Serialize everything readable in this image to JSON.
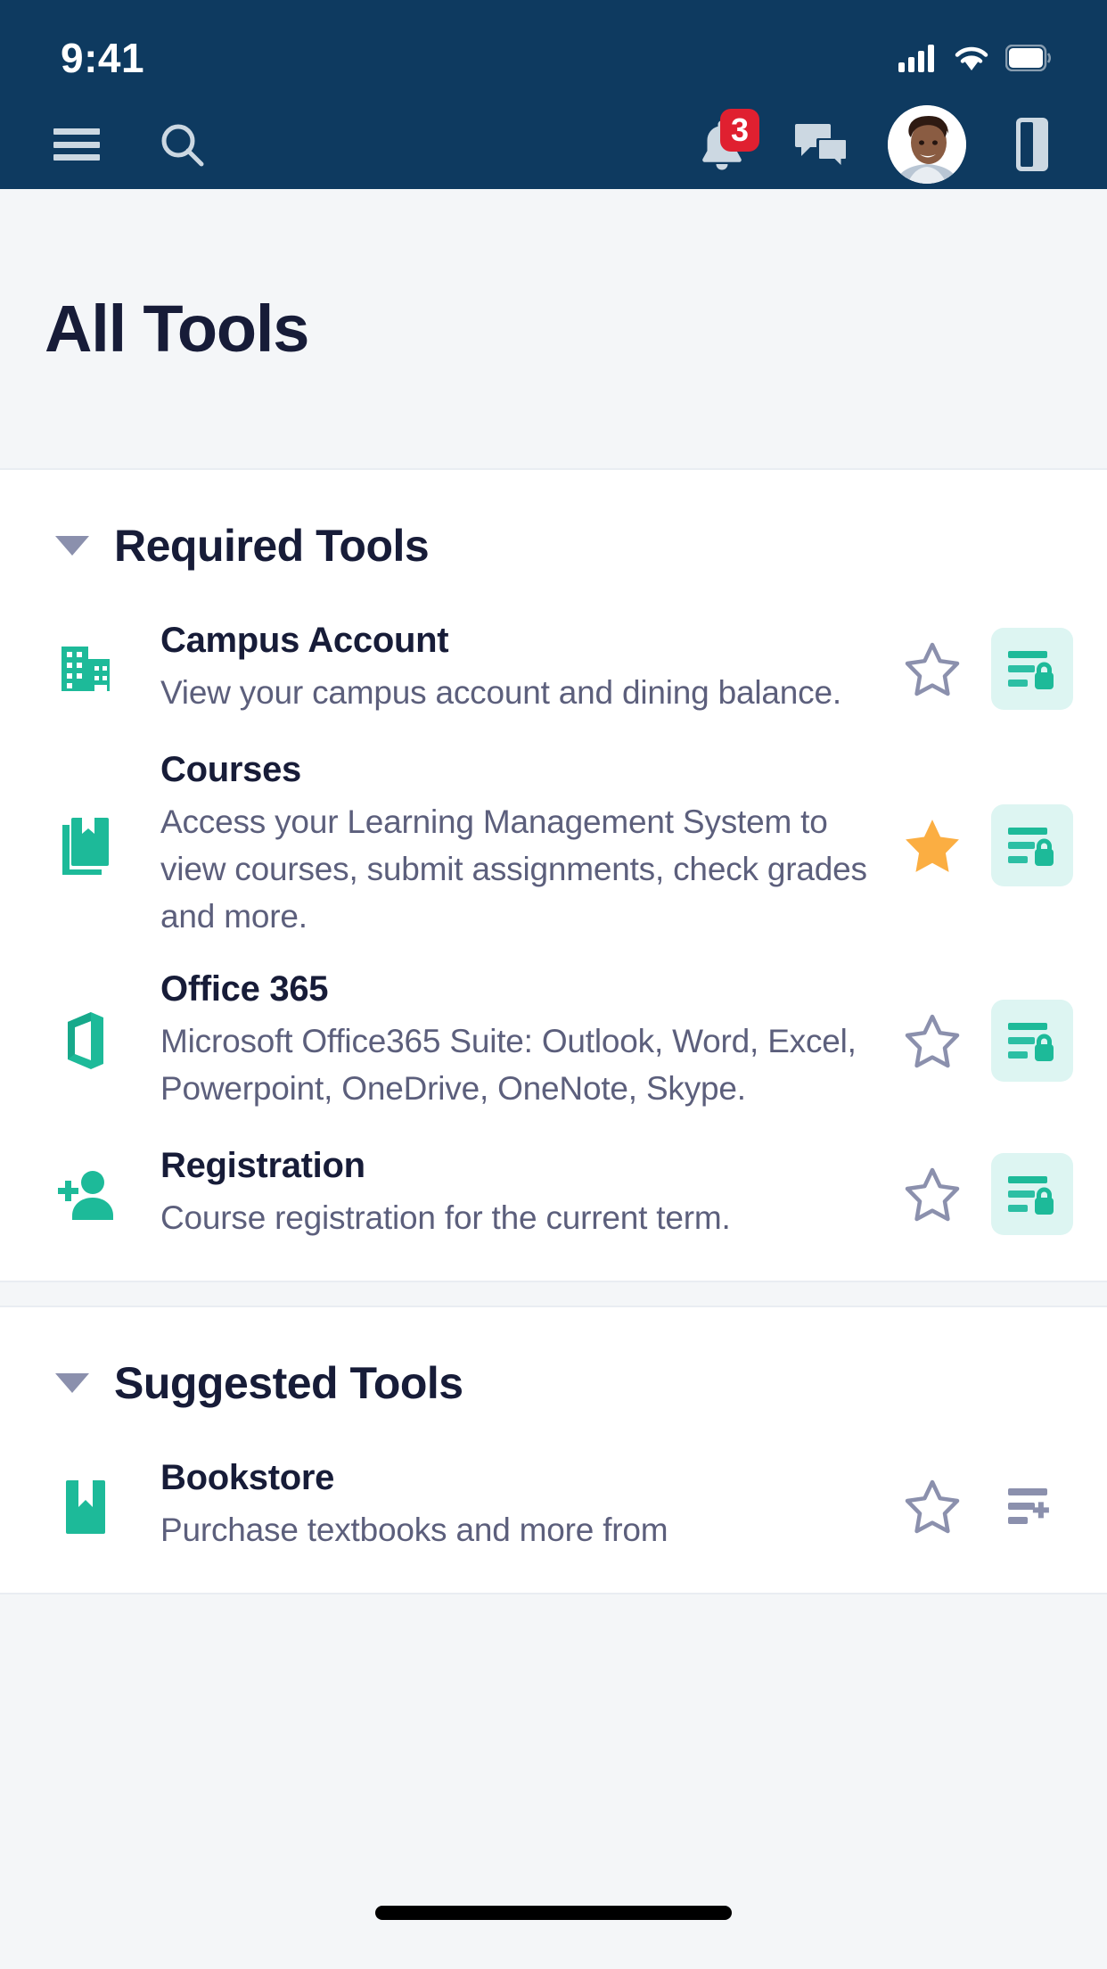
{
  "status_bar": {
    "time": "9:41",
    "icons": [
      "cellular-signal-icon",
      "wifi-icon",
      "battery-icon"
    ]
  },
  "app_bar": {
    "left_icons": [
      {
        "name": "hamburger-menu-icon",
        "label": "Menu"
      },
      {
        "name": "search-icon",
        "label": "Search"
      }
    ],
    "right_icons": [
      {
        "name": "notifications-bell-icon",
        "label": "Notifications",
        "badge": "3"
      },
      {
        "name": "messages-chat-icon",
        "label": "Messages"
      },
      {
        "name": "avatar",
        "label": "Profile"
      },
      {
        "name": "side-panel-icon",
        "label": "Panel"
      }
    ],
    "notification_badge": "3"
  },
  "page": {
    "title": "All Tools"
  },
  "colors": {
    "header_blue": "#0e3a60",
    "page_bg": "#f4f6f8",
    "title_navy": "#171c38",
    "body_text": "#5c5f7c",
    "teal": "#1dba99",
    "teal_soft": "#ddf5f2",
    "star_on": "#fbae42",
    "star_off": "#8b90ad",
    "badge_red": "#e02030"
  },
  "sections": [
    {
      "id": "required-tools",
      "title": "Required Tools",
      "expanded": true,
      "chevron": "chevron-down-icon",
      "tools": [
        {
          "name": "Campus Account",
          "description": "View your campus account and dining balance.",
          "icon": "building-icon",
          "favorite": false,
          "star_icon": "star-outline-icon",
          "action_icon": "list-lock-icon",
          "action_style": "locked"
        },
        {
          "name": "Courses",
          "description": "Access your Learning Management System to view courses, submit assignments, check grades and more.",
          "icon": "book-bookmark-icon",
          "favorite": true,
          "star_icon": "star-filled-icon",
          "action_icon": "list-lock-icon",
          "action_style": "locked"
        },
        {
          "name": "Office 365",
          "description": "Microsoft Office365 Suite: Outlook, Word, Excel, Powerpoint, OneDrive, OneNote, Skype.",
          "icon": "office-365-icon",
          "favorite": false,
          "star_icon": "star-outline-icon",
          "action_icon": "list-lock-icon",
          "action_style": "locked"
        },
        {
          "name": "Registration",
          "description": "Course registration for the current term.",
          "icon": "person-add-icon",
          "favorite": false,
          "star_icon": "star-outline-icon",
          "action_icon": "list-lock-icon",
          "action_style": "locked"
        }
      ]
    },
    {
      "id": "suggested-tools",
      "title": "Suggested Tools",
      "expanded": true,
      "chevron": "chevron-down-icon",
      "tools": [
        {
          "name": "Bookstore",
          "description": "Purchase textbooks and more from",
          "icon": "open-book-icon",
          "favorite": false,
          "star_icon": "star-outline-icon",
          "action_icon": "list-add-icon",
          "action_style": "plain"
        }
      ]
    }
  ]
}
